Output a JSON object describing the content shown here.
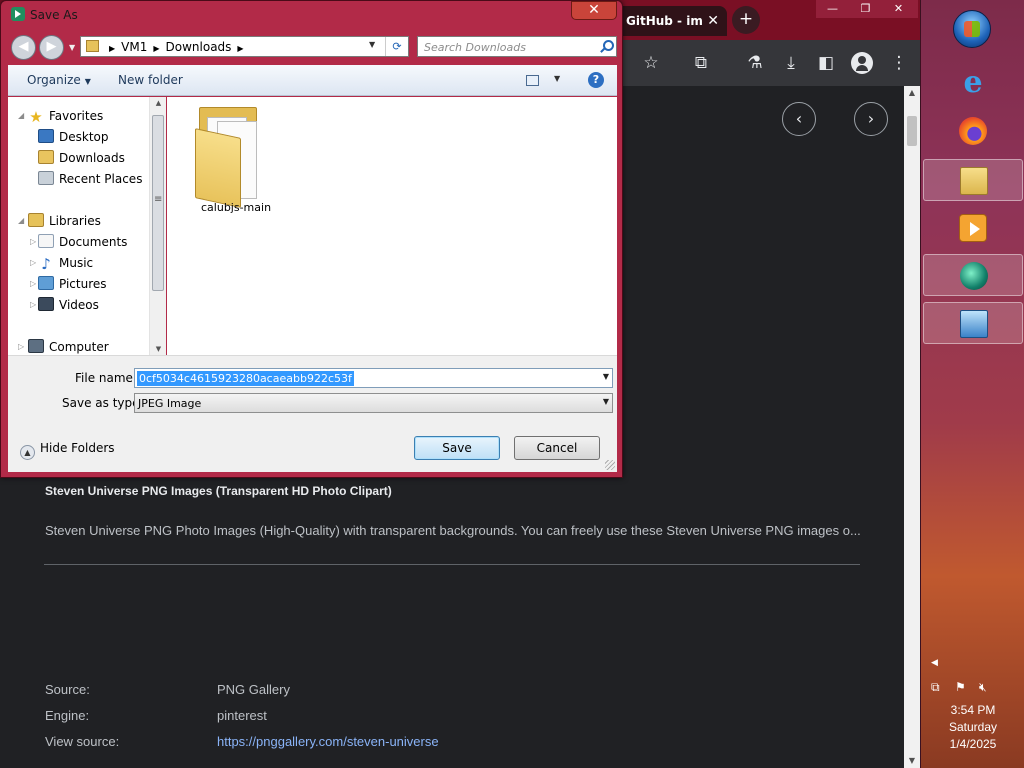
{
  "browser": {
    "active_tab_title": "GitHub - im",
    "tab_close": "✕",
    "new_tab": "+",
    "window_controls": [
      "—",
      "❐",
      "✕"
    ],
    "toolbar_icons": [
      "star-icon",
      "extensions-icon",
      "labs-icon",
      "download-icon",
      "side-panel-icon",
      "profile-icon",
      "menu-icon"
    ],
    "image_title": "Steven Universe PNG Images (Transparent HD Photo Clipart)",
    "image_description": "Steven Universe PNG Photo Images (High-Quality) with transparent backgrounds. You can freely use these Steven Universe PNG images o...",
    "meta": [
      {
        "label": "Source:",
        "value": "PNG Gallery"
      },
      {
        "label": "Engine:",
        "value": "pinterest"
      },
      {
        "label": "View source:",
        "value": "https://pnggallery.com/steven-universe"
      }
    ]
  },
  "dialog": {
    "title": "Save As",
    "close": "✕",
    "breadcrumb": [
      "VM1",
      "Downloads"
    ],
    "search_placeholder": "Search Downloads",
    "organize": "Organize",
    "new_folder": "New folder",
    "help": "?",
    "nav": {
      "favorites": "Favorites",
      "desktop": "Desktop",
      "downloads": "Downloads",
      "recent_places": "Recent Places",
      "libraries": "Libraries",
      "documents": "Documents",
      "music": "Music",
      "pictures": "Pictures",
      "videos": "Videos",
      "computer": "Computer"
    },
    "folder_name": "calubjs-main",
    "file_name_label": "File name:",
    "file_name_value": "0cf5034c4615923280acaeabb922c53f",
    "save_type_label": "Save as type:",
    "save_type_value": "JPEG Image",
    "hide_folders": "Hide Folders",
    "save": "Save",
    "cancel": "Cancel"
  },
  "taskbar": {
    "time": "3:54 PM",
    "day": "Saturday",
    "date": "1/4/2025"
  }
}
